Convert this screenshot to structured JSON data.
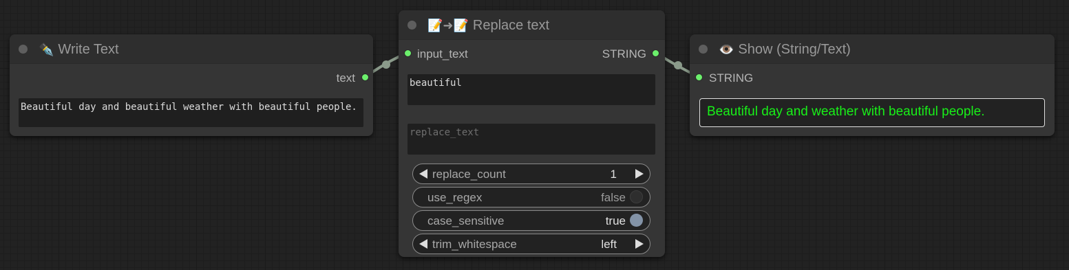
{
  "nodes": {
    "write": {
      "title_icon": "✒️",
      "title": "Write Text",
      "output_label": "text",
      "text_value": "Beautiful day and beautiful weather with beautiful people."
    },
    "replace": {
      "title_icon": "📝➜📝",
      "title": "Replace text",
      "input_label": "input_text",
      "output_label": "STRING",
      "find_value": "beautiful",
      "replace_placeholder": "replace_text",
      "replace_count": {
        "label": "replace_count",
        "value": "1"
      },
      "use_regex": {
        "label": "use_regex",
        "value": "false"
      },
      "case_sensitive": {
        "label": "case_sensitive",
        "value": "true"
      },
      "trim_whitespace": {
        "label": "trim_whitespace",
        "value": "left"
      }
    },
    "show": {
      "title_icon": "👁️",
      "title": "Show (String/Text)",
      "input_label": "STRING",
      "display_text": "Beautiful day and weather with beautiful people."
    }
  },
  "colors": {
    "slot_string": "#6cf06c",
    "show_text": "#18f018",
    "link": "#8a9a8a",
    "toggle_on": "#8393a7"
  }
}
